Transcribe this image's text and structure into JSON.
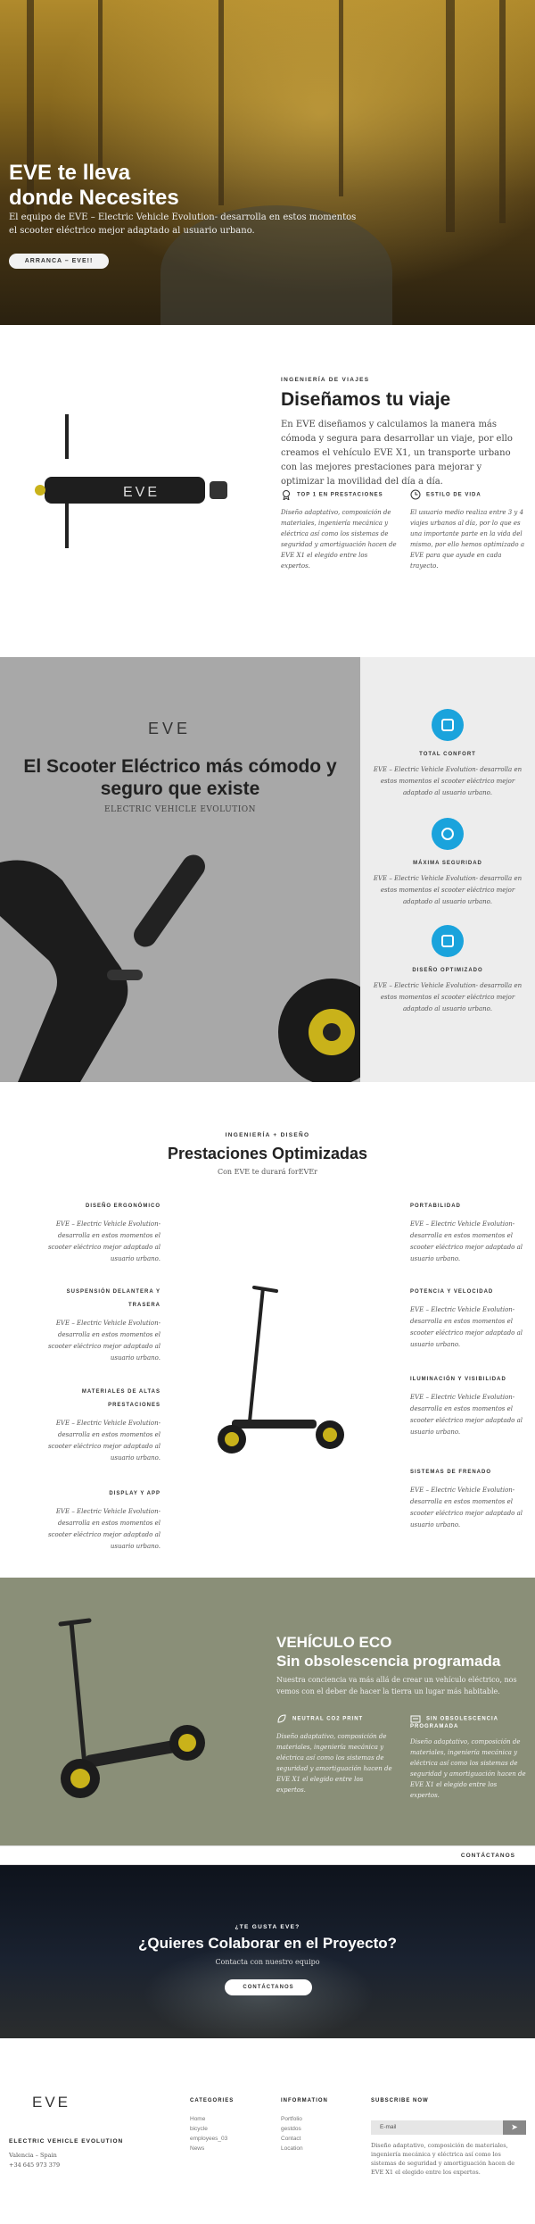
{
  "hero": {
    "title_line1": "EVE te lleva",
    "title_line2": "donde Necesites",
    "subtitle": "El equipo de EVE – Electric Vehicle Evolution- desarrolla en estos momentos el scooter eléctrico mejor adaptado al usuario urbano.",
    "cta": "ARRANCA – EVE!!"
  },
  "design": {
    "kicker": "INGENIERÍA DE VIAJES",
    "title": "Diseñamos tu viaje",
    "lead": "En EVE diseñamos y calculamos la manera más cómoda y segura para desarrollar un viaje, por ello creamos el vehículo EVE X1, un transporte urbano con las mejores prestaciones para mejorar y optimizar la movilidad del día a día.",
    "features": [
      {
        "title": "TOP 1 EN PRESTACIONES",
        "icon": "award-icon",
        "desc": "Diseño adaptativo, composición de materiales, ingeniería mecánica y eléctrica así como los sistemas de seguridad y amortiguación hacen de EVE X1 el elegido entre los expertos."
      },
      {
        "title": "ESTILO DE VIDA",
        "icon": "clock-icon",
        "desc": "El usuario medio realiza entre 3 y 4 viajes urbanos al día, por lo que es una importante parte en la vida del mismo, por ello hemos optimizado a EVE para que ayude en cada trayecto."
      }
    ]
  },
  "split": {
    "logo": "EVE",
    "title": "El Scooter Eléctrico más cómodo y seguro que existe",
    "tagline": "ELECTRIC VEHICLE EVOLUTION",
    "features": [
      {
        "title": "TOTAL CONFORT",
        "icon": "tablet-icon",
        "desc": "EVE – Electric Vehicle Evolution- desarrolla en estos momentos el scooter eléctrico mejor adaptado al usuario urbano."
      },
      {
        "title": "MÁXIMA SEGURIDAD",
        "icon": "camera-icon",
        "desc": "EVE – Electric Vehicle Evolution- desarrolla en estos momentos el scooter eléctrico mejor adaptado al usuario urbano."
      },
      {
        "title": "DISEÑO OPTIMIZADO",
        "icon": "devices-icon",
        "desc": "EVE – Electric Vehicle Evolution- desarrolla en estos momentos el scooter eléctrico mejor adaptado al usuario urbano."
      }
    ]
  },
  "perf": {
    "kicker": "INGENIERÍA + DISEÑO",
    "title": "Prestaciones Optimizadas",
    "subtitle": "Con EVE te durará forEVEr",
    "left": [
      {
        "title": "DISEÑO ERGONÓMICO",
        "desc": "EVE – Electric Vehicle Evolution- desarrolla en estos momentos el scooter eléctrico mejor adaptado al usuario urbano."
      },
      {
        "title": "SUSPENSIÓN DELANTERA Y TRASERA",
        "desc": "EVE – Electric Vehicle Evolution- desarrolla en estos momentos el scooter eléctrico mejor adaptado al usuario urbano."
      },
      {
        "title": "MATERIALES DE ALTAS PRESTACIONES",
        "desc": "EVE – Electric Vehicle Evolution- desarrolla en estos momentos el scooter eléctrico mejor adaptado al usuario urbano."
      },
      {
        "title": "DISPLAY Y APP",
        "desc": "EVE – Electric Vehicle Evolution- desarrolla en estos momentos el scooter eléctrico mejor adaptado al usuario urbano."
      }
    ],
    "right": [
      {
        "title": "PORTABILIDAD",
        "desc": "EVE – Electric Vehicle Evolution- desarrolla en estos momentos el scooter eléctrico mejor adaptado al usuario urbano."
      },
      {
        "title": "POTENCIA Y VELOCIDAD",
        "desc": "EVE – Electric Vehicle Evolution- desarrolla en estos momentos el scooter eléctrico mejor adaptado al usuario urbano."
      },
      {
        "title": "ILUMINACIÓN Y VISIBILIDAD",
        "desc": "EVE – Electric Vehicle Evolution- desarrolla en estos momentos el scooter eléctrico mejor adaptado al usuario urbano."
      },
      {
        "title": "SISTEMAS DE FRENADO",
        "desc": "EVE – Electric Vehicle Evolution- desarrolla en estos momentos el scooter eléctrico mejor adaptado al usuario urbano."
      }
    ]
  },
  "eco": {
    "title_line1": "VEHÍCULO ECO",
    "title_line2": "Sin obsolescencia programada",
    "lead": "Nuestra conciencia va más allá de crear un vehículo eléctrico, nos vemos con el deber de hacer la tierra un lugar más habitable.",
    "features": [
      {
        "title": "NEUTRAL CO2 PRINT",
        "icon": "leaf-icon",
        "desc": "Diseño adaptativo, composición de materiales, ingeniería mecánica y eléctrica así como los sistemas de seguridad y amortiguación hacen de EVE X1 el elegido entre los expertos."
      },
      {
        "title": "SIN OBSOLESCENCIA PROGRAMADA",
        "icon": "recycle-icon",
        "desc": "Diseño adaptativo, composición de materiales, ingeniería mecánica y eléctrica así como los sistemas de seguridad y amortiguación hacen de EVE X1 el elegido entre los expertos."
      }
    ]
  },
  "contact_bar": {
    "link": "CONTÁCTANOS"
  },
  "collab": {
    "kicker": "¿TE GUSTA EVE?",
    "title": "¿Quieres Colaborar en el Proyecto?",
    "subtitle": "Contacta con nuestro equipo",
    "cta": "CONTÁCTANOS"
  },
  "footer": {
    "logo": "EVE",
    "brand": "ELECTRIC VEHICLE EVOLUTION",
    "address": "Valencia – Spain",
    "phone": "+34 645 973 379",
    "categories": {
      "heading": "CATEGORIES",
      "links": [
        "Home",
        "bicycle",
        "employees_03",
        "News"
      ]
    },
    "information": {
      "heading": "INFORMATION",
      "links": [
        "Portfolio",
        "gestdos",
        "Contact",
        "Location"
      ]
    },
    "subscribe": {
      "heading": "SUBSCRIBE NOW",
      "placeholder": "E-mail",
      "button": "➤",
      "desc": "Diseño adaptativo, composición de materiales, ingeniería mecánica y eléctrica así como los sistemas de seguridad y amortiguación hacen de EVE X1 el elegido entre los expertos."
    }
  },
  "colors": {
    "accent": "#1aa3dc",
    "eco_bg": "#8a8f78",
    "split_left": "#a8a8a8",
    "scooter_yellow": "#c9b21a"
  }
}
